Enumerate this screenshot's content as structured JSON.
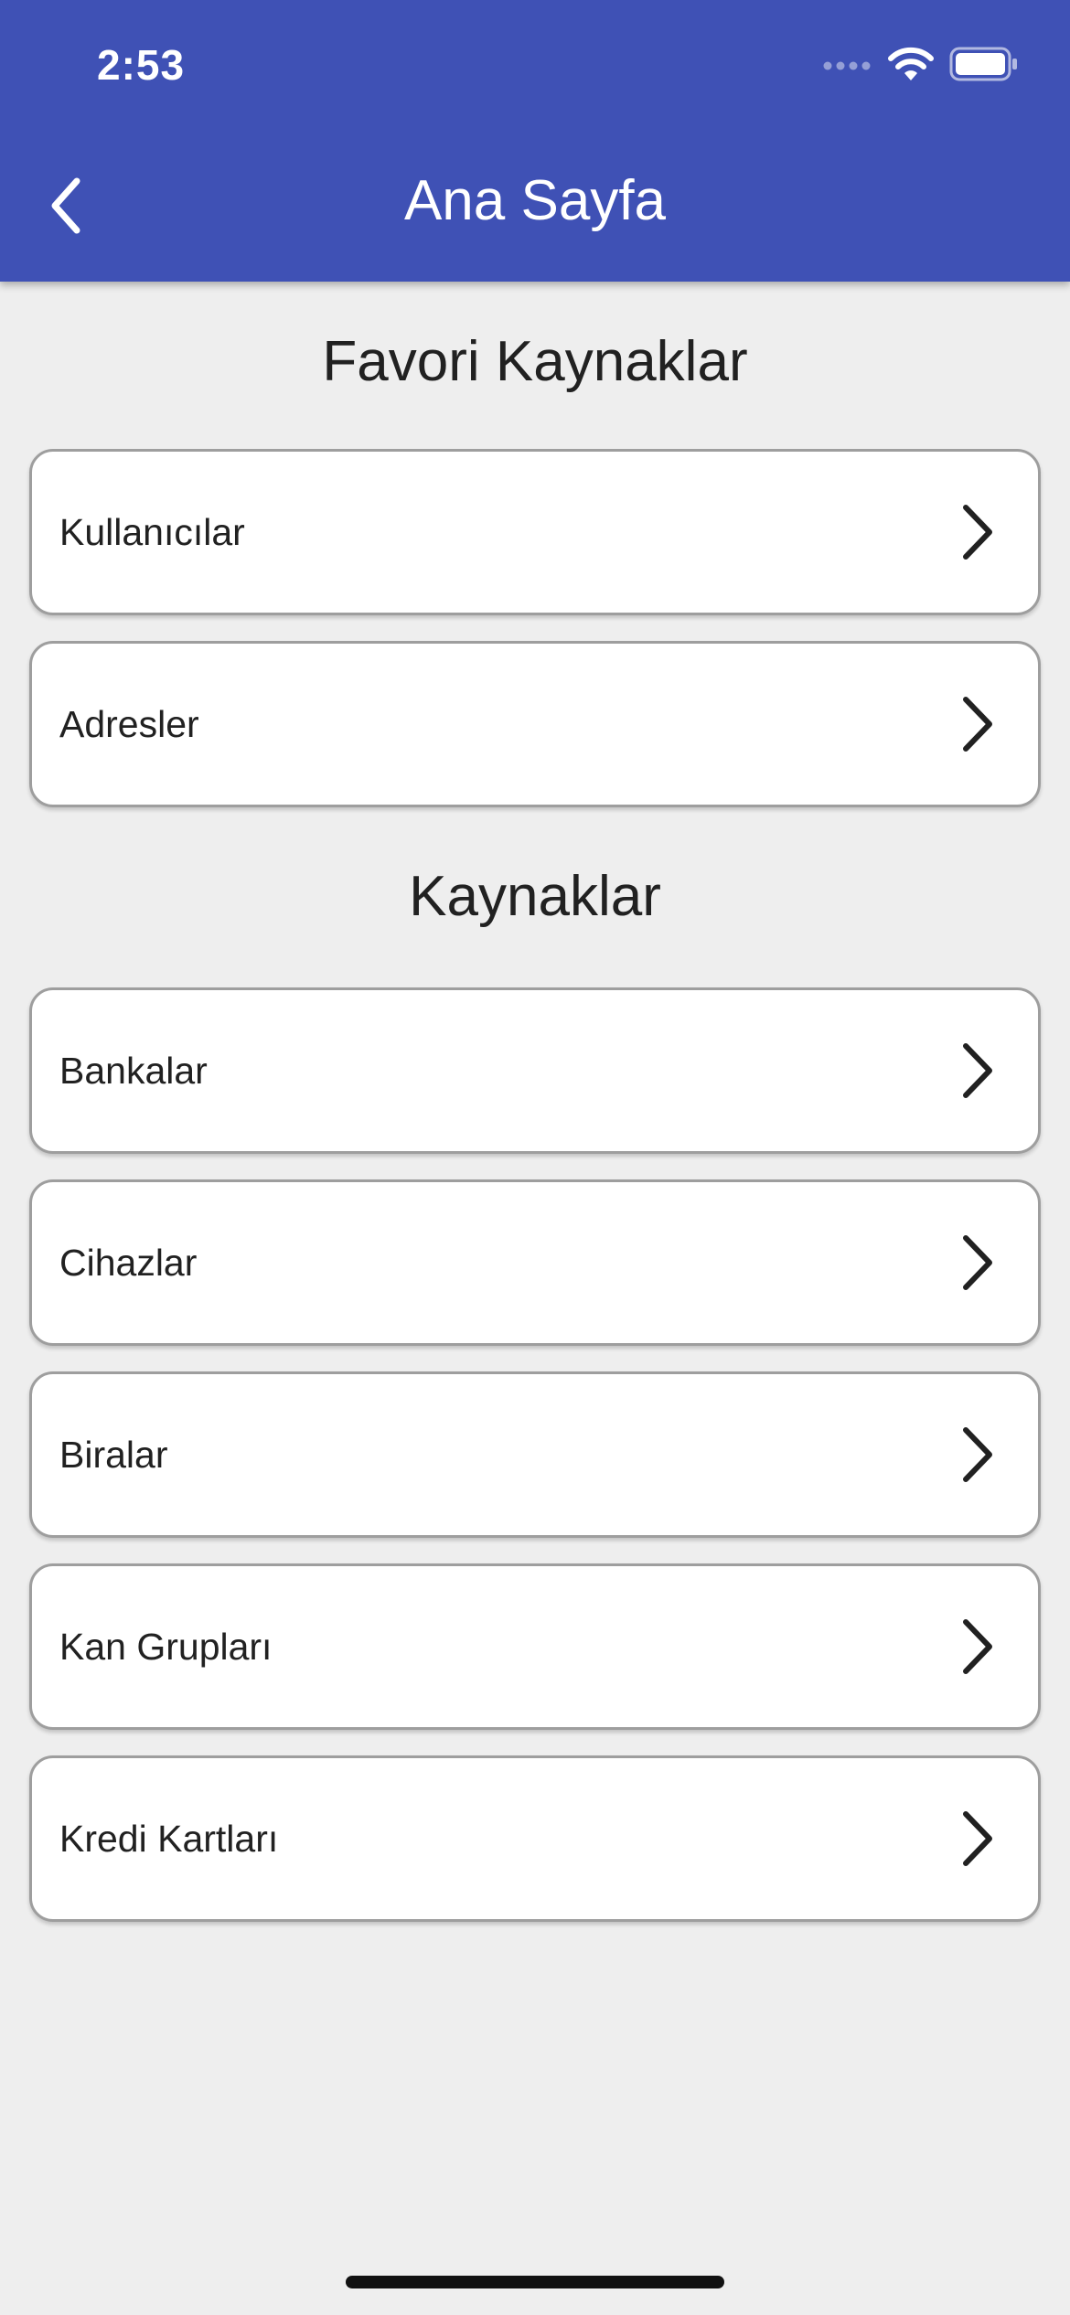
{
  "status_bar": {
    "time": "2:53",
    "icons": [
      "cellular-signal-icon",
      "wifi-icon",
      "battery-icon"
    ]
  },
  "app_bar": {
    "title": "Ana Sayfa",
    "back_icon": "chevron-left-icon",
    "color": "#3f51b5"
  },
  "favorites": {
    "title": "Favori Kaynaklar",
    "items": [
      {
        "label": "Kullanıcılar"
      },
      {
        "label": "Adresler"
      }
    ]
  },
  "resources": {
    "title": "Kaynaklar",
    "items": [
      {
        "label": "Bankalar"
      },
      {
        "label": "Cihazlar"
      },
      {
        "label": "Biralar"
      },
      {
        "label": "Kan Grupları"
      },
      {
        "label": "Kredi Kartları"
      }
    ]
  },
  "item_icon": "chevron-right-icon"
}
